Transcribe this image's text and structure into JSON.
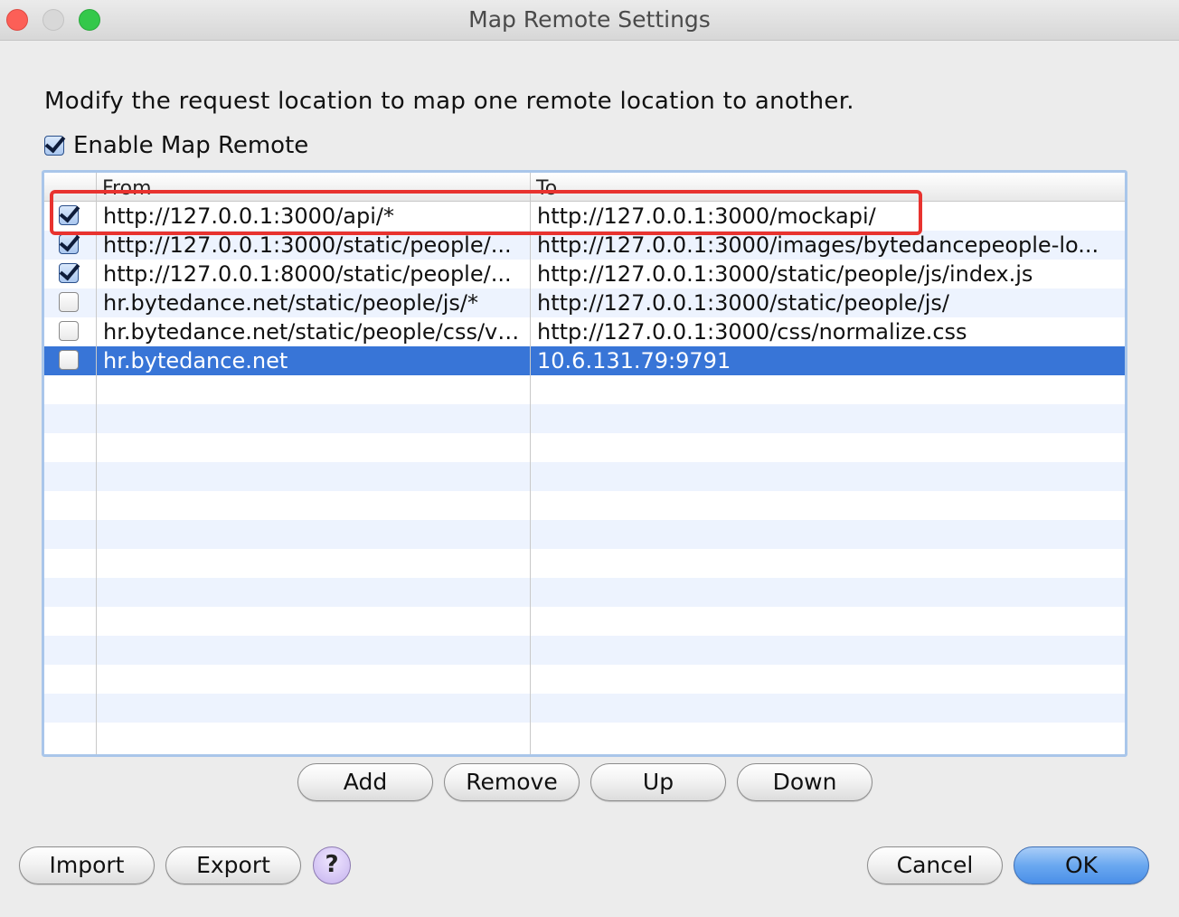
{
  "window": {
    "title": "Map Remote Settings"
  },
  "instructions": "Modify the request location to map one remote location to another.",
  "enable": {
    "label": "Enable Map Remote",
    "checked": true
  },
  "table": {
    "columns": [
      "",
      "From",
      "To"
    ],
    "rows": [
      {
        "enabled": true,
        "from": "http://127.0.0.1:3000/api/*",
        "to": "http://127.0.0.1:3000/mockapi/"
      },
      {
        "enabled": true,
        "from": "http://127.0.0.1:3000/static/people/...",
        "to": "http://127.0.0.1:3000/images/bytedancepeople-lo..."
      },
      {
        "enabled": true,
        "from": "http://127.0.0.1:8000/static/people/...",
        "to": "http://127.0.0.1:3000/static/people/js/index.js"
      },
      {
        "enabled": false,
        "from": "hr.bytedance.net/static/people/js/*",
        "to": "http://127.0.0.1:3000/static/people/js/"
      },
      {
        "enabled": false,
        "from": "hr.bytedance.net/static/people/css/ve...",
        "to": "http://127.0.0.1:3000/css/normalize.css"
      },
      {
        "enabled": false,
        "from": "hr.bytedance.net",
        "to": "10.6.131.79:9791",
        "selected": true
      }
    ]
  },
  "table_buttons": {
    "add": "Add",
    "remove": "Remove",
    "up": "Up",
    "down": "Down"
  },
  "footer": {
    "import": "Import",
    "export": "Export",
    "help": "?",
    "cancel": "Cancel",
    "ok": "OK"
  },
  "colors": {
    "selection": "#3875d7",
    "highlight_box": "#e8332f",
    "alt_row": "#edf3fe"
  }
}
